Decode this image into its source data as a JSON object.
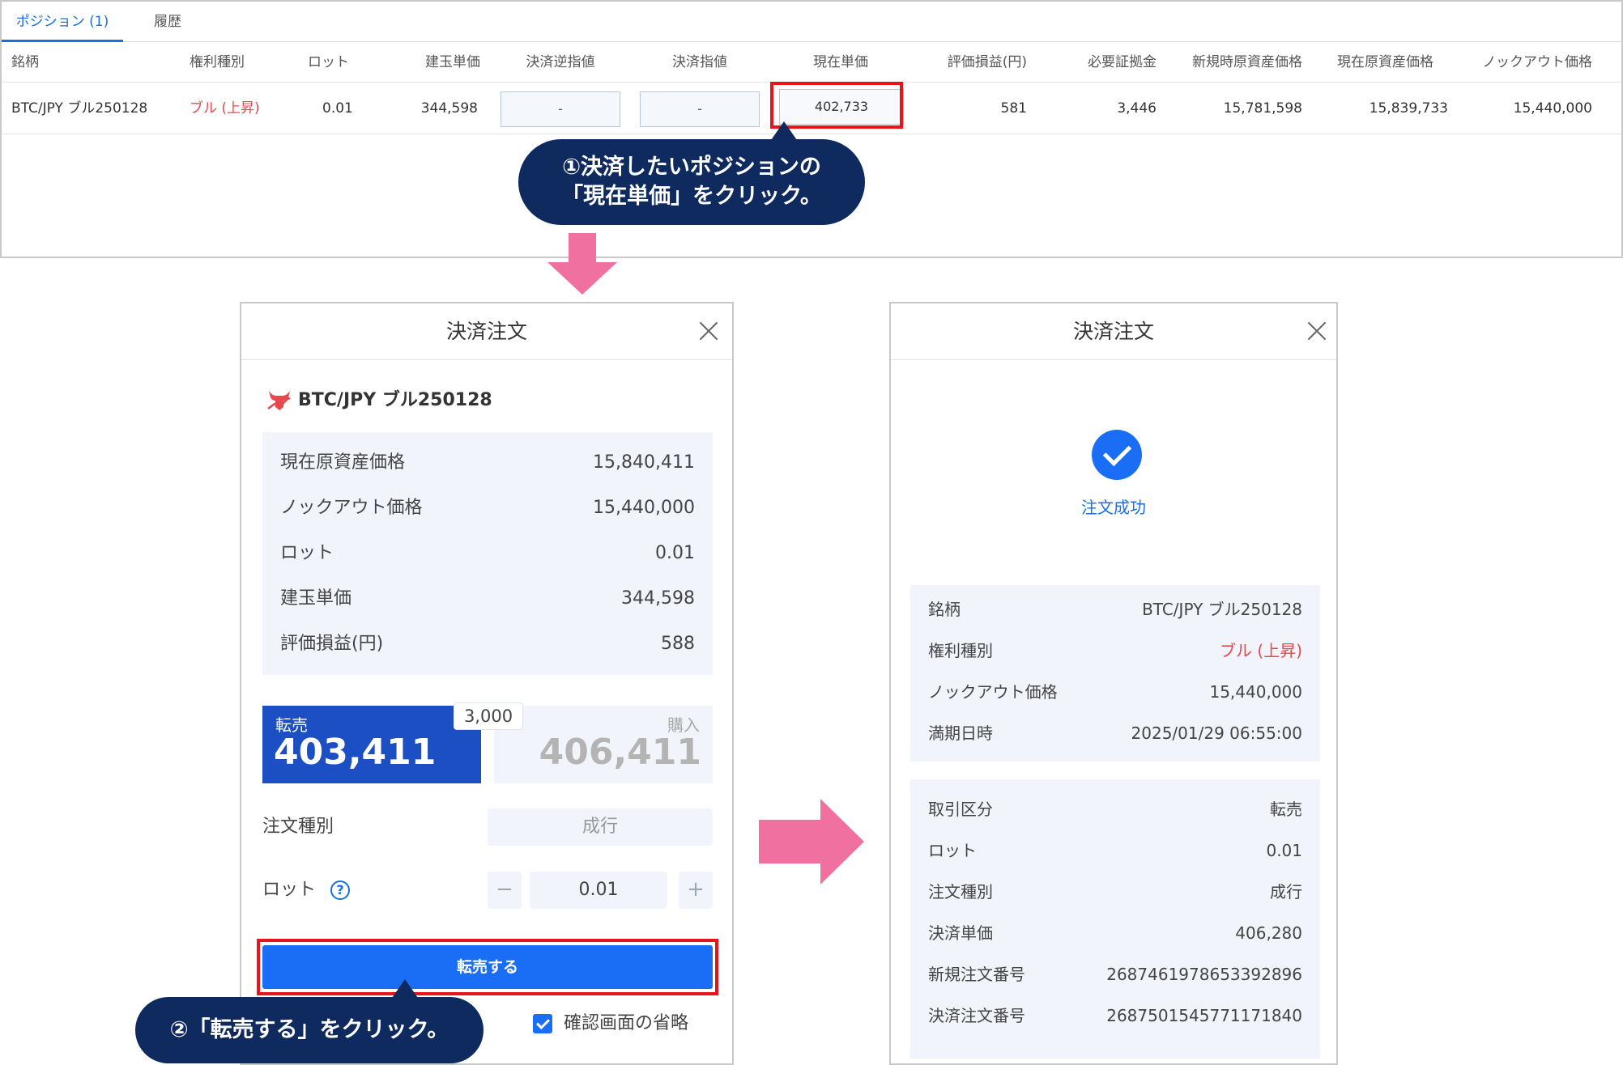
{
  "top_panel": {
    "tabs": [
      {
        "label": "ポジション (1)"
      },
      {
        "label": "履歴"
      }
    ],
    "columns": [
      "銘柄",
      "権利種別",
      "ロット",
      "建玉単価",
      "決済逆指値",
      "決済指値",
      "現在単価",
      "評価損益(円)",
      "必要証拠金",
      "新規時原資産価格",
      "現在原資産価格",
      "ノックアウト価格"
    ],
    "row": {
      "symbol": "BTC/JPY ブル250128",
      "type": "ブル (上昇)",
      "lot": "0.01",
      "entry_price": "344,598",
      "stop_order": "-",
      "limit_order": "-",
      "current_price": "402,733",
      "pnl": "581",
      "margin": "3,446",
      "initial_underlying": "15,781,598",
      "current_underlying": "15,839,733",
      "knockout": "15,440,000"
    }
  },
  "callouts": {
    "step1_line1": "①決済したいポジションの",
    "step1_line2": "「現在単価」をクリック。",
    "step2": "②「転売する」をクリック。"
  },
  "modal_order": {
    "title": "決済注文",
    "asset": "BTC/JPY ブル250128",
    "info": [
      {
        "label": "現在原資産価格",
        "value": "15,840,411"
      },
      {
        "label": "ノックアウト価格",
        "value": "15,440,000"
      },
      {
        "label": "ロット",
        "value": "0.01"
      },
      {
        "label": "建玉単価",
        "value": "344,598"
      },
      {
        "label": "評価損益(円)",
        "value": "588"
      }
    ],
    "sell_label": "転売",
    "sell_price": "403,411",
    "buy_label": "購入",
    "buy_price": "406,411",
    "spread": "3,000",
    "order_type_label": "注文種別",
    "order_type_value": "成行",
    "lot_label": "ロット",
    "lot_value": "0.01",
    "minus": "−",
    "plus": "+",
    "help": "?",
    "submit_label": "転売する",
    "skip_label": "確認画面の省略"
  },
  "modal_success": {
    "title": "決済注文",
    "status": "注文成功",
    "info1": [
      {
        "label": "銘柄",
        "value": "BTC/JPY ブル250128"
      },
      {
        "label": "権利種別",
        "value": "ブル (上昇)"
      },
      {
        "label": "ノックアウト価格",
        "value": "15,440,000"
      },
      {
        "label": "満期日時",
        "value": "2025/01/29 06:55:00"
      }
    ],
    "info2": [
      {
        "label": "取引区分",
        "value": "転売"
      },
      {
        "label": "ロット",
        "value": "0.01"
      },
      {
        "label": "注文種別",
        "value": "成行"
      },
      {
        "label": "決済単価",
        "value": "406,280"
      },
      {
        "label": "新規注文番号",
        "value": "2687461978653392896"
      },
      {
        "label": "決済注文番号",
        "value": "2687501545771171840"
      }
    ]
  },
  "colors": {
    "accent": "#1a6ef5",
    "highlight": "#e8141c",
    "callout": "#0e2a5e",
    "arrow": "#f0709f",
    "bull": "#e5484d"
  }
}
